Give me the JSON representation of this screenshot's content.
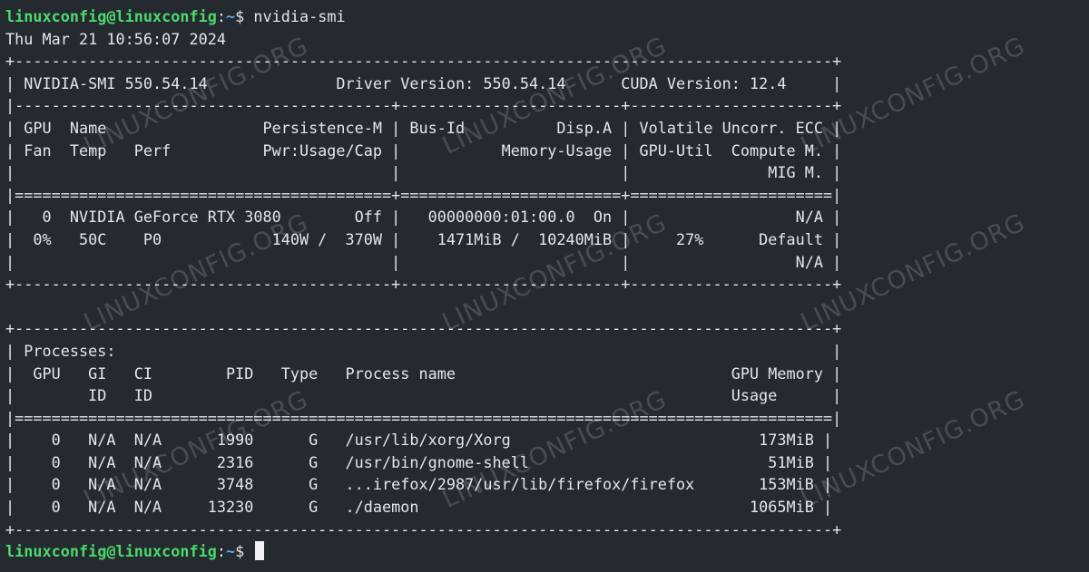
{
  "terminal": {
    "prompt": {
      "user_host": "linuxconfig@linuxconfig",
      "separator": ":",
      "path": "~",
      "dollar": "$ "
    },
    "command": "nvidia-smi",
    "output": [
      "Thu Mar 21 10:56:07 2024",
      "+-----------------------------------------------------------------------------------------+",
      "| NVIDIA-SMI 550.54.14              Driver Version: 550.54.14      CUDA Version: 12.4     |",
      "|-----------------------------------------+------------------------+----------------------+",
      "| GPU  Name                 Persistence-M | Bus-Id          Disp.A | Volatile Uncorr. ECC |",
      "| Fan  Temp   Perf          Pwr:Usage/Cap |           Memory-Usage | GPU-Util  Compute M. |",
      "|                                         |                        |               MIG M. |",
      "|=========================================+========================+======================|",
      "|   0  NVIDIA GeForce RTX 3080        Off |   00000000:01:00.0  On |                  N/A |",
      "|  0%   50C    P0            140W /  370W |    1471MiB /  10240MiB |     27%      Default |",
      "|                                         |                        |                  N/A |",
      "+-----------------------------------------+------------------------+----------------------+",
      "",
      "+-----------------------------------------------------------------------------------------+",
      "| Processes:                                                                              |",
      "|  GPU   GI   CI        PID   Type   Process name                              GPU Memory |",
      "|        ID   ID                                                               Usage      |",
      "|=========================================================================================|",
      "|    0   N/A  N/A      1990      G   /usr/lib/xorg/Xorg                           173MiB |",
      "|    0   N/A  N/A      2316      G   /usr/bin/gnome-shell                          51MiB |",
      "|    0   N/A  N/A      3748      G   ...irefox/2987/usr/lib/firefox/firefox       153MiB |",
      "|    0   N/A  N/A     13230      G   ./daemon                                    1065MiB |",
      "+-----------------------------------------------------------------------------------------+"
    ]
  },
  "watermark": {
    "text": "LINUXCONFIG.ORG"
  },
  "colors": {
    "background": "#252a31",
    "foreground": "#e4e6ea",
    "prompt_user": "#4cd96b",
    "prompt_path": "#5fa8e6"
  }
}
